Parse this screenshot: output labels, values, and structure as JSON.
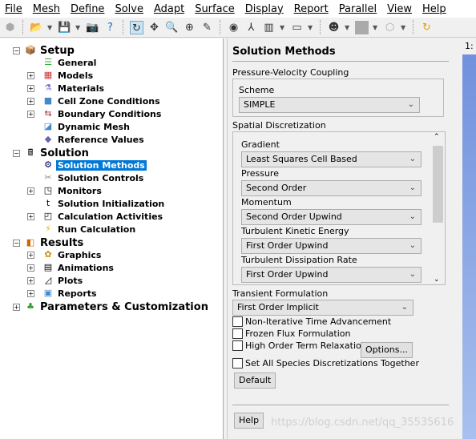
{
  "menu": [
    "File",
    "Mesh",
    "Define",
    "Solve",
    "Adapt",
    "Surface",
    "Display",
    "Report",
    "Parallel",
    "View",
    "Help"
  ],
  "tree": {
    "setup": "Setup",
    "general": "General",
    "models": "Models",
    "materials": "Materials",
    "cell_zone": "Cell Zone Conditions",
    "boundary": "Boundary Conditions",
    "dynamic_mesh": "Dynamic Mesh",
    "reference": "Reference Values",
    "solution": "Solution",
    "methods": "Solution Methods",
    "controls": "Solution Controls",
    "monitors": "Monitors",
    "init": "Solution Initialization",
    "calc_act": "Calculation Activities",
    "run": "Run Calculation",
    "results": "Results",
    "graphics": "Graphics",
    "animations": "Animations",
    "plots": "Plots",
    "reports": "Reports",
    "params": "Parameters & Customization"
  },
  "panel": {
    "title": "Solution Methods",
    "pv_coupling": "Pressure-Velocity Coupling",
    "scheme_label": "Scheme",
    "scheme": "SIMPLE",
    "spatial": "Spatial Discretization",
    "items": [
      {
        "label": "Gradient",
        "value": "Least Squares Cell Based"
      },
      {
        "label": "Pressure",
        "value": "Second Order"
      },
      {
        "label": "Momentum",
        "value": "Second Order Upwind"
      },
      {
        "label": "Turbulent Kinetic Energy",
        "value": "First Order Upwind"
      },
      {
        "label": "Turbulent Dissipation Rate",
        "value": "First Order Upwind"
      }
    ],
    "transient_label": "Transient Formulation",
    "transient": "First Order Implicit",
    "checks": [
      {
        "label": "Non-Iterative Time Advancement",
        "checked": false
      },
      {
        "label": "Frozen Flux Formulation",
        "checked": false
      },
      {
        "label": "High Order Term Relaxation",
        "checked": false
      },
      {
        "label": "Set All Species Discretizations Together",
        "checked": false
      }
    ],
    "options": "Options...",
    "default": "Default",
    "help": "Help"
  },
  "graphics_tab": "1:",
  "watermark": "https://blog.csdn.net/qq_35535616"
}
